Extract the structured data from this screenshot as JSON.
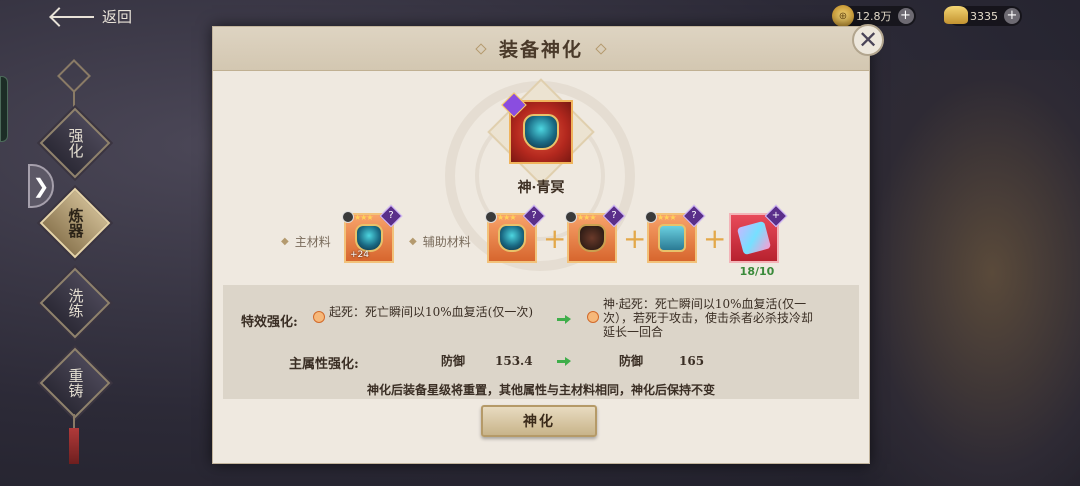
{
  "top": {
    "back_label": "返回",
    "coins": "12.8万",
    "gold": "3335",
    "coin_symbol": "⊕"
  },
  "sidebar": {
    "items": [
      {
        "label": "强化",
        "active": false
      },
      {
        "label": "炼器",
        "active": true
      },
      {
        "label": "洗练",
        "active": false
      },
      {
        "label": "重铸",
        "active": false
      }
    ],
    "toggle_glyph": "❯"
  },
  "dialog": {
    "title": "装备神化",
    "close_glyph": "✕",
    "equipment_name": "神·青冥",
    "main_material_label": "主材料",
    "aux_material_label": "辅助材料",
    "main_material_level": "+24",
    "stars": "★★★",
    "unknown_glyph": "?",
    "plus_glyph": "+",
    "crystal_count": "18/10",
    "effect_label": "特效强化:",
    "effect_before": "起死：死亡瞬间以10%血复活(仅一次)",
    "effect_after": "神·起死：死亡瞬间以10%血复活(仅一次），若死于攻击，使击杀者必杀技冷却延长一回合",
    "attr_label": "主属性强化:",
    "attr_name_before": "防御",
    "attr_value_before": "153.4",
    "attr_name_after": "防御",
    "attr_value_after": "165",
    "note": "神化后装备星级将重置，其他属性与主材料相同，神化后保持不变",
    "confirm_label": "神化"
  }
}
